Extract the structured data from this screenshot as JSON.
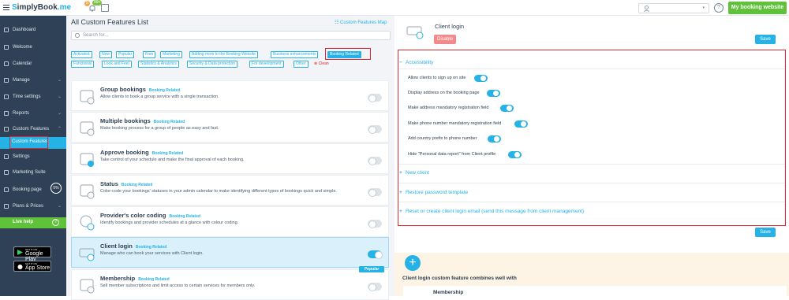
{
  "brand": {
    "prefix": "S",
    "name": "implyBook",
    "suffix": ".me"
  },
  "topbar": {
    "badge_orange": "5",
    "badge_green": "99+",
    "help": "?",
    "my_booking_website": "My booking website"
  },
  "sidebar": {
    "items": [
      {
        "label": "Dashboard",
        "icon": "dashboard-icon"
      },
      {
        "label": "Welcome",
        "icon": "pin-icon"
      },
      {
        "label": "Calendar",
        "icon": "calendar-icon"
      },
      {
        "label": "Manage",
        "icon": "pencil-icon"
      },
      {
        "label": "Time settings",
        "icon": "clock-icon"
      },
      {
        "label": "Reports",
        "icon": "chart-icon"
      },
      {
        "label": "Custom Features",
        "icon": "puzzle-icon"
      },
      {
        "label": "Settings",
        "icon": "gear-icon"
      },
      {
        "label": "Marketing Suite",
        "icon": "megaphone-icon"
      },
      {
        "label": "Booking page",
        "icon": "page-icon"
      },
      {
        "label": "Plans & Prices",
        "icon": "tag-icon"
      }
    ],
    "sub_active": "Custom Features",
    "booking_page_percent": "5%",
    "live_help": "Live help",
    "live_help_q": "?",
    "google_play_small": "GET IT ON",
    "google_play": "Google Play",
    "app_store_small": "GET IT ON",
    "app_store": "App Store"
  },
  "main": {
    "title": "All Custom Features List",
    "custom_map": "Custom Features Map",
    "search_placeholder": "Search for...",
    "tags": [
      "Activated",
      "New",
      "Popular",
      "Free",
      "Marketing",
      "Adding more to the Booking Website",
      "Business enhancements",
      "Booking Related",
      "Functional",
      "Look and Feel",
      "Statistics & Analytics",
      "Security & Data protection",
      "For development",
      "Other"
    ],
    "active_tag": "Booking Related",
    "clean": "Clean",
    "features": [
      {
        "title": "Group bookings",
        "badge": "Booking Related",
        "desc": "Allow clients to book a group service with a single transaction.",
        "on": false
      },
      {
        "title": "Multiple bookings",
        "badge": "Booking Related",
        "desc": "Make booking process for a group of people as easy and fast.",
        "on": false
      },
      {
        "title": "Approve booking",
        "badge": "Booking Related",
        "desc": "Take control of your schedule and make the final approval of each booking.",
        "on": false
      },
      {
        "title": "Status",
        "badge": "Booking Related",
        "desc": "Color-code your bookings' statuses in your admin calendar to make identifying different types of bookings quick and simple.",
        "on": false
      },
      {
        "title": "Provider's color coding",
        "badge": "Booking Related",
        "desc": "Identify bookings and provider schedules at a glance with colour coding.",
        "on": false
      },
      {
        "title": "Client login",
        "badge": "Booking Related",
        "desc": "Manage who can book your services with Client login.",
        "on": true
      },
      {
        "title": "Membership",
        "badge": "Booking Related",
        "desc": "Sell member subscriptions and limit access to certain services for members only.",
        "on": false
      }
    ],
    "popular": "Popular"
  },
  "panel": {
    "title": "Client login",
    "disable": "Disable",
    "save": "Save",
    "accessibility": "Accessibility",
    "options": [
      "Allow clients to sign up on site",
      "Display address on the booking page",
      "Make address mandatory registration field",
      "Make phone number mandatory registration field",
      "Add country prefix to phone number",
      "Hide \"Personal data report\" from Client profile"
    ],
    "sections": [
      "New client",
      "Restore password template",
      "Reset or create client login email (send this message from client management)"
    ],
    "plus": "+",
    "combines_text": "Client login custom feature combines well with",
    "combine_first": "Membership"
  },
  "colors": {
    "accent": "#25b2e6",
    "sidebar": "#2f4156",
    "green": "#60c13b",
    "highlight": "#e0252c"
  }
}
